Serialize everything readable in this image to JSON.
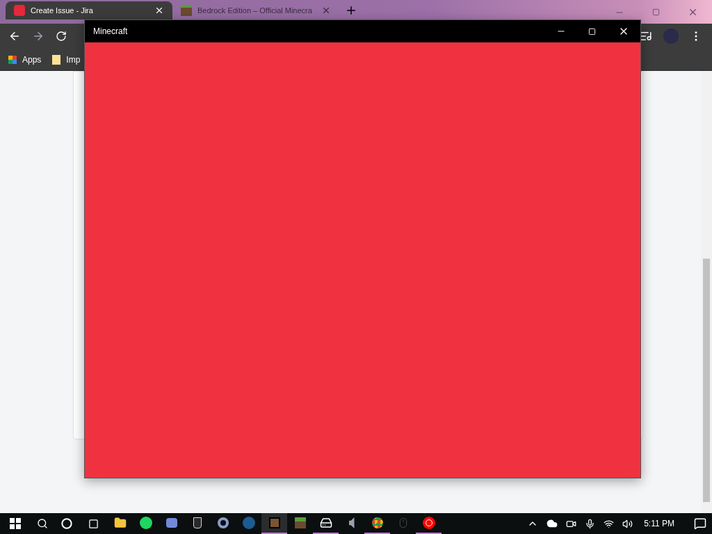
{
  "browser": {
    "tabs": [
      {
        "title": "Create Issue - Jira",
        "selected": true,
        "kind": "jira"
      },
      {
        "title": "Bedrock Edition – Official Minecra",
        "selected": false,
        "kind": "grass"
      }
    ],
    "bookmarks": [
      {
        "label": "Apps",
        "kind": "apps"
      },
      {
        "label": "Imp",
        "kind": "folder"
      }
    ]
  },
  "app_window": {
    "title": "Minecraft"
  },
  "taskbar": {
    "apps": [
      {
        "kind": "explorer",
        "running": false,
        "selected": false
      },
      {
        "kind": "spotify",
        "running": false,
        "selected": false
      },
      {
        "kind": "discord",
        "running": false,
        "selected": false
      },
      {
        "kind": "epic",
        "running": false,
        "selected": false
      },
      {
        "kind": "ring",
        "running": false,
        "selected": false
      },
      {
        "kind": "steam",
        "running": false,
        "selected": false
      },
      {
        "kind": "minecraft",
        "running": true,
        "selected": true
      },
      {
        "kind": "grass",
        "running": false,
        "selected": false
      },
      {
        "kind": "device",
        "running": true,
        "selected": false
      },
      {
        "kind": "speaker",
        "running": false,
        "selected": false
      },
      {
        "kind": "chrome",
        "running": true,
        "selected": false
      },
      {
        "kind": "mouse",
        "running": false,
        "selected": false
      },
      {
        "kind": "ytmusic",
        "running": true,
        "selected": false
      }
    ],
    "clock": "5:11 PM"
  }
}
